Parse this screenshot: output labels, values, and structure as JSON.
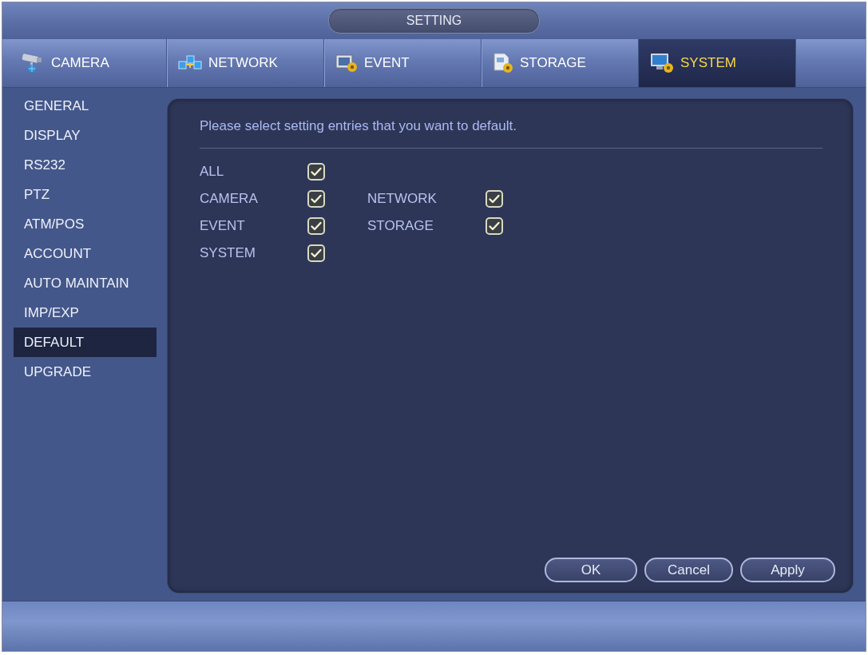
{
  "window": {
    "title": "SETTING"
  },
  "tabs": [
    {
      "label": "CAMERA",
      "selected": false
    },
    {
      "label": "NETWORK",
      "selected": false
    },
    {
      "label": "EVENT",
      "selected": false
    },
    {
      "label": "STORAGE",
      "selected": false
    },
    {
      "label": "SYSTEM",
      "selected": true
    }
  ],
  "sidebar": {
    "items": [
      {
        "label": "GENERAL",
        "selected": false
      },
      {
        "label": "DISPLAY",
        "selected": false
      },
      {
        "label": "RS232",
        "selected": false
      },
      {
        "label": "PTZ",
        "selected": false
      },
      {
        "label": "ATM/POS",
        "selected": false
      },
      {
        "label": "ACCOUNT",
        "selected": false
      },
      {
        "label": "AUTO MAINTAIN",
        "selected": false
      },
      {
        "label": "IMP/EXP",
        "selected": false
      },
      {
        "label": "DEFAULT",
        "selected": true
      },
      {
        "label": "UPGRADE",
        "selected": false
      }
    ]
  },
  "panel": {
    "instruction": "Please select setting entries that you want to default.",
    "rows": [
      {
        "entries": [
          {
            "label": "ALL",
            "checked": true
          }
        ]
      },
      {
        "entries": [
          {
            "label": "CAMERA",
            "checked": true
          },
          {
            "label": "NETWORK",
            "checked": true
          }
        ]
      },
      {
        "entries": [
          {
            "label": "EVENT",
            "checked": true
          },
          {
            "label": "STORAGE",
            "checked": true
          }
        ]
      },
      {
        "entries": [
          {
            "label": "SYSTEM",
            "checked": true
          }
        ]
      }
    ],
    "buttons": [
      "OK",
      "Cancel",
      "Apply"
    ]
  }
}
